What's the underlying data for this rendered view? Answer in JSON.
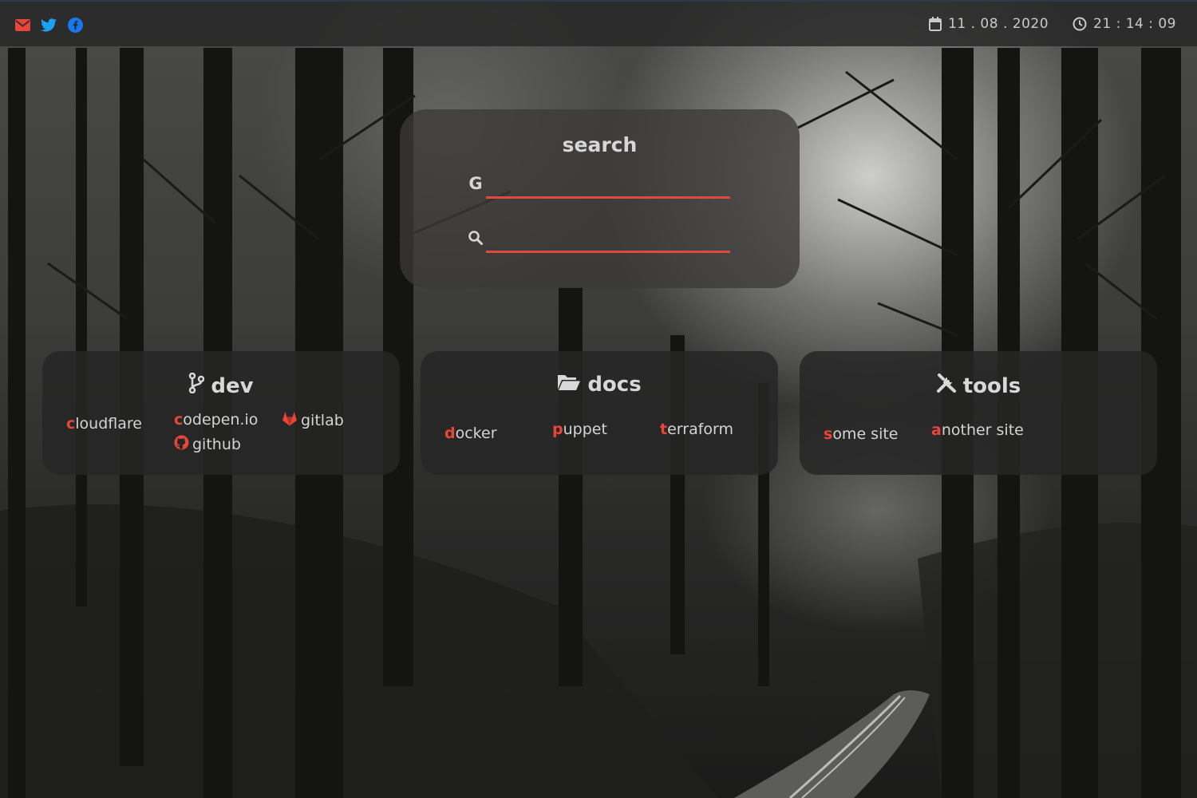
{
  "topbar": {
    "social": [
      {
        "icon": "envelope-icon",
        "color": "#e8463a"
      },
      {
        "icon": "twitter-icon",
        "color": "#1da1f2"
      },
      {
        "icon": "facebook-icon",
        "color": "#1877f2"
      }
    ],
    "date": "11 . 08 . 2020",
    "time": "21 : 14 : 09"
  },
  "search": {
    "title": "search",
    "google_label": "G",
    "google_value": "",
    "site_value": ""
  },
  "cards": {
    "dev": {
      "title": "dev",
      "links": [
        {
          "first": "c",
          "rest": "loudflare"
        },
        {
          "first": "c",
          "rest": "odepen.io"
        },
        {
          "icon": "gitlab-icon",
          "rest": "gitlab"
        },
        {
          "icon": "github-icon",
          "rest": "github"
        }
      ]
    },
    "docs": {
      "title": "docs",
      "links": [
        {
          "first": "d",
          "rest": "ocker"
        },
        {
          "first": "p",
          "rest": "uppet"
        },
        {
          "first": "t",
          "rest": "erraform"
        }
      ]
    },
    "tools": {
      "title": "tools",
      "links": [
        {
          "first": "s",
          "rest": "ome site"
        },
        {
          "first": "a",
          "rest": "nother site"
        }
      ]
    }
  },
  "colors": {
    "accent": "#e8463a",
    "card_bg": "#262626",
    "text": "#d8d8d8"
  }
}
